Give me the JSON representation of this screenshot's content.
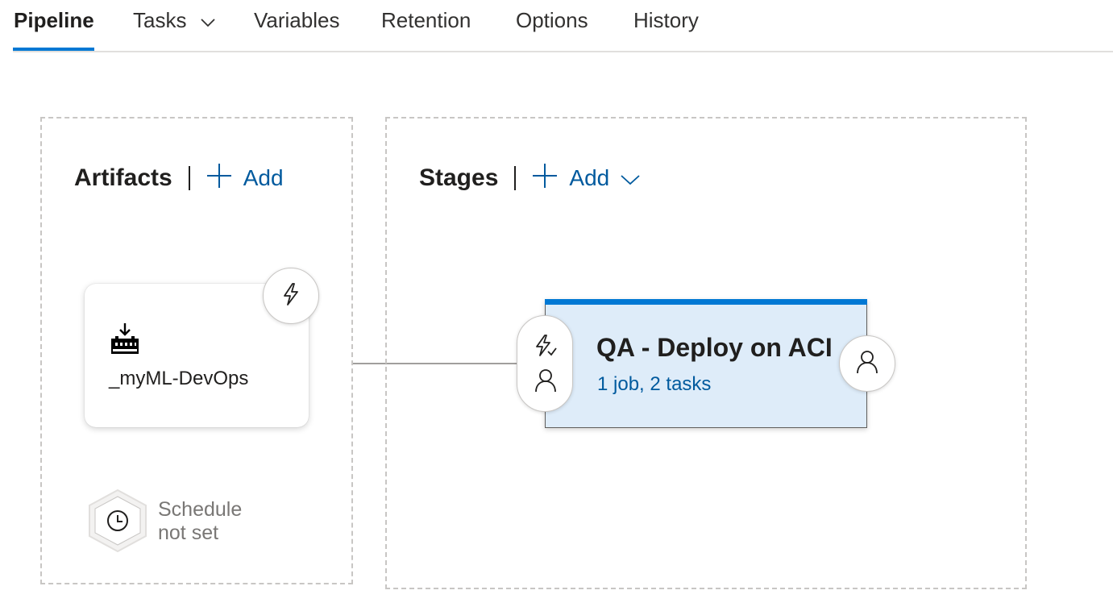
{
  "tabs": [
    {
      "label": "Pipeline",
      "active": true
    },
    {
      "label": "Tasks",
      "has_dropdown": true
    },
    {
      "label": "Variables"
    },
    {
      "label": "Retention"
    },
    {
      "label": "Options"
    },
    {
      "label": "History"
    }
  ],
  "artifacts": {
    "title": "Artifacts",
    "add_label": "Add",
    "items": [
      {
        "name": "_myML-DevOps",
        "icon": "build-artifact-icon",
        "trigger_icon": "lightning-icon"
      }
    ],
    "schedule": {
      "line1": "Schedule",
      "line2": "not set",
      "icon": "clock-icon"
    }
  },
  "stages": {
    "title": "Stages",
    "add_label": "Add",
    "items": [
      {
        "name": "QA - Deploy on ACI",
        "summary": "1 job, 2 tasks",
        "pre_icons": [
          "lightning-icon",
          "person-icon"
        ],
        "post_icon": "person-icon"
      }
    ]
  },
  "colors": {
    "accent": "#0078d4",
    "link": "#005a9e",
    "stage_fill": "#deecf9",
    "muted": "#797775"
  }
}
